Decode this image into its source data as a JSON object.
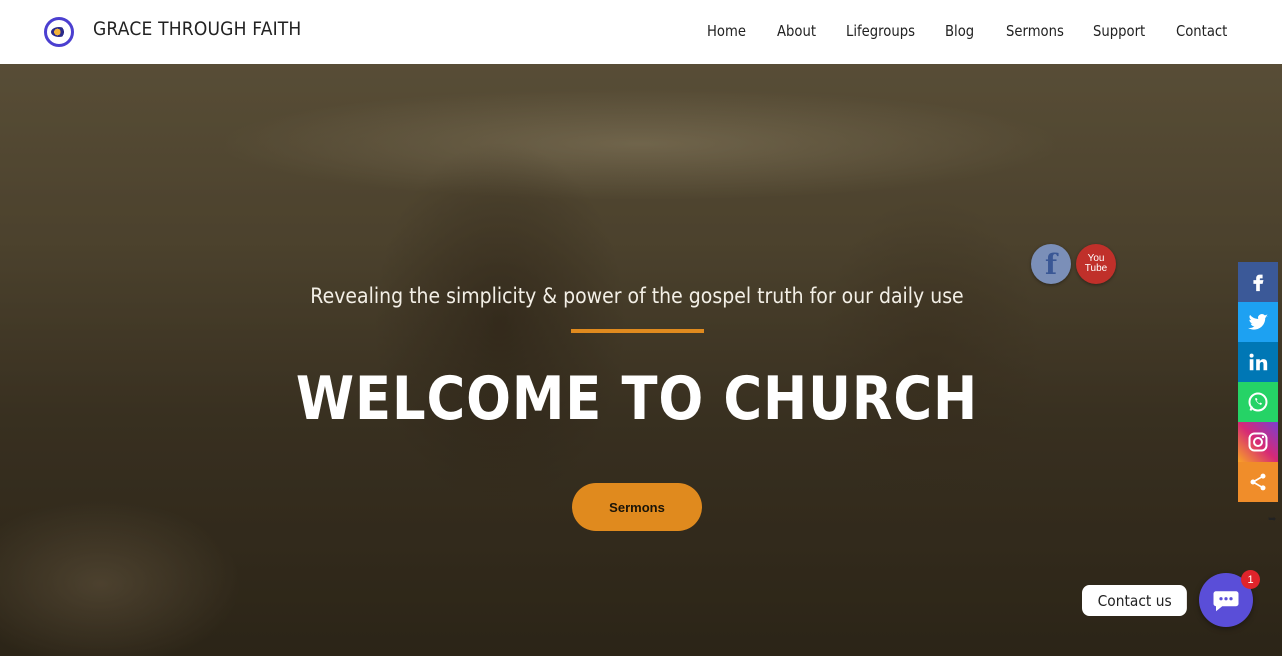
{
  "header": {
    "site_title": "GRACE THROUGH FAITH",
    "nav": [
      "Home",
      "About",
      "Lifegroups",
      "Blog",
      "Sermons",
      "Support",
      "Contact"
    ]
  },
  "hero": {
    "tagline": "Revealing the simplicity & power of the gospel truth for our daily use",
    "headline": "WELCOME TO CHURCH",
    "cta_label": "Sermons",
    "accent_color": "#e08a1e"
  },
  "floating_social": {
    "youtube_label": "You Tube"
  },
  "social_bar": [
    {
      "name": "facebook-icon",
      "color": "#3b5998"
    },
    {
      "name": "twitter-icon",
      "color": "#1da1f2"
    },
    {
      "name": "linkedin-icon",
      "color": "#0077b5"
    },
    {
      "name": "whatsapp-icon",
      "color": "#25d366"
    },
    {
      "name": "instagram-icon",
      "color": "#d62976"
    },
    {
      "name": "share-icon",
      "color": "#f08d2a"
    }
  ],
  "contact_widget": {
    "label": "Contact us",
    "badge_count": "1",
    "color": "#5a4ed8"
  }
}
